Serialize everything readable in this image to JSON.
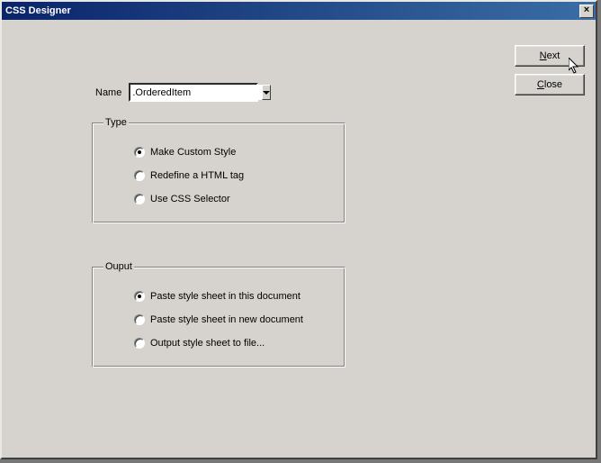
{
  "window": {
    "title": "CSS Designer",
    "close_symbol": "×"
  },
  "buttons": {
    "next": {
      "prefix": "",
      "key": "N",
      "suffix": "ext"
    },
    "close": {
      "prefix": "",
      "key": "C",
      "suffix": "lose"
    }
  },
  "name": {
    "label": "Name",
    "value": ".OrderedItem"
  },
  "groups": {
    "type": {
      "legend": "Type",
      "options": [
        {
          "label": "Make Custom Style",
          "checked": true
        },
        {
          "label": "Redefine a HTML tag",
          "checked": false
        },
        {
          "label": "Use CSS Selector",
          "checked": false
        }
      ]
    },
    "output": {
      "legend": "Ouput",
      "options": [
        {
          "label": "Paste style sheet in this document",
          "checked": true
        },
        {
          "label": "Paste style sheet in new document",
          "checked": false
        },
        {
          "label": "Output style sheet to file...",
          "checked": false
        }
      ]
    }
  }
}
